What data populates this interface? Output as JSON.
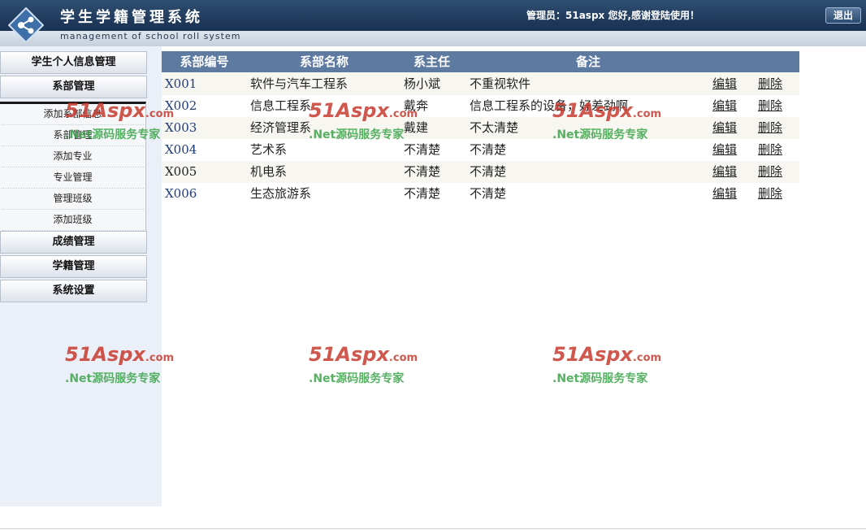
{
  "header": {
    "title": "学生学籍管理系统",
    "subtitle": "management of school roll system",
    "welcome": "管理员：51aspx 您好,感谢登陆使用！",
    "logout_label": "退出"
  },
  "sidebar": {
    "menus": [
      {
        "label": "学生个人信息管理"
      },
      {
        "label": "系部管理"
      },
      {
        "label": "成绩管理"
      },
      {
        "label": "学籍管理"
      },
      {
        "label": "系统设置"
      }
    ],
    "submenu": [
      {
        "label": "添加系部信息"
      },
      {
        "label": "系部管理"
      },
      {
        "label": "添加专业"
      },
      {
        "label": "专业管理"
      },
      {
        "label": "管理班级"
      },
      {
        "label": "添加班级"
      }
    ]
  },
  "table": {
    "columns": [
      "系部编号",
      "系部名称",
      "系主任",
      "备注"
    ],
    "rows": [
      {
        "id": "X001",
        "name": "软件与汽车工程系",
        "head": "杨小斌",
        "note": "不重视软件",
        "edit": "编辑",
        "delete": "删除"
      },
      {
        "id": "X002",
        "name": "信息工程系",
        "head": "戴奔",
        "note": "信息工程系的设备，好差劲啊",
        "edit": "编辑",
        "delete": "删除"
      },
      {
        "id": "X003",
        "name": "经济管理系",
        "head": "戴建",
        "note": "不太清楚",
        "edit": "编辑",
        "delete": "删除"
      },
      {
        "id": "X004",
        "name": "艺术系",
        "head": "不清楚",
        "note": "不清楚",
        "edit": "编辑",
        "delete": "删除"
      },
      {
        "id": "X005",
        "name": "机电系",
        "head": "不清楚",
        "note": "不清楚",
        "edit": "编辑",
        "delete": "删除"
      },
      {
        "id": "X006",
        "name": "生态旅游系",
        "head": "不清楚",
        "note": "不清楚",
        "edit": "编辑",
        "delete": "删除"
      }
    ]
  },
  "watermark": {
    "brand": "51Aspx",
    "domain": ".com",
    "tagline": ".Net源码服务专家"
  },
  "colors": {
    "header_bg": "#1d3556",
    "table_header_bg": "#5e7aa0",
    "sidebar_bg": "#ebeff7",
    "row_alt_bg": "#f7f6f0"
  }
}
